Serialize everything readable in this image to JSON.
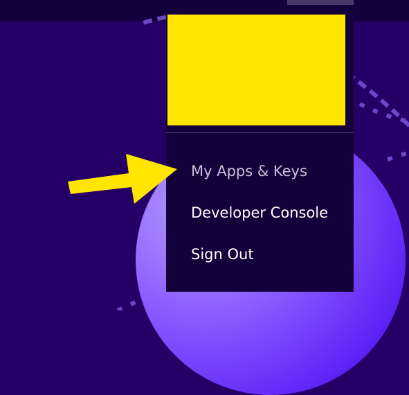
{
  "menu": {
    "items": [
      {
        "label": "My Apps & Keys"
      },
      {
        "label": "Developer Console"
      },
      {
        "label": "Sign Out"
      }
    ]
  },
  "colors": {
    "background": "#240066",
    "topbar": "#14003a",
    "menu_bg": "#14003a",
    "highlight": "#ffe500",
    "muted_text": "#c8c0d8",
    "text": "#ffffff"
  },
  "icons": {
    "annotation": "arrow-right-icon"
  }
}
